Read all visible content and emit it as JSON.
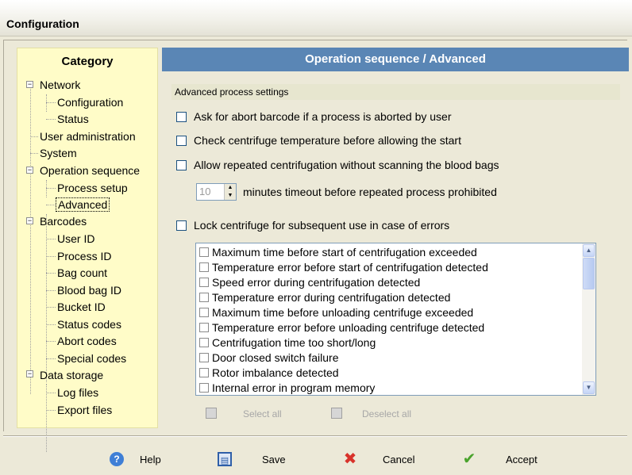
{
  "window": {
    "title": "Configuration"
  },
  "sidebar": {
    "title": "Category",
    "items": [
      {
        "label": "Network"
      },
      {
        "label": "Configuration"
      },
      {
        "label": "Status"
      },
      {
        "label": "User administration"
      },
      {
        "label": "System"
      },
      {
        "label": "Operation sequence"
      },
      {
        "label": "Process setup"
      },
      {
        "label": "Advanced"
      },
      {
        "label": "Barcodes"
      },
      {
        "label": "User ID"
      },
      {
        "label": "Process ID"
      },
      {
        "label": "Bag count"
      },
      {
        "label": "Blood bag ID"
      },
      {
        "label": "Bucket ID"
      },
      {
        "label": "Status codes"
      },
      {
        "label": "Abort codes"
      },
      {
        "label": "Special codes"
      },
      {
        "label": "Data storage"
      },
      {
        "label": "Log files"
      },
      {
        "label": "Export files"
      }
    ],
    "selected": "Advanced"
  },
  "main": {
    "header": "Operation sequence / Advanced",
    "section": "Advanced process settings",
    "options": [
      {
        "label": "Ask for abort barcode if a process is aborted by user",
        "checked": false
      },
      {
        "label": "Check centrifuge temperature before allowing the start",
        "checked": false
      },
      {
        "label": "Allow repeated centrifugation without scanning the blood bags",
        "checked": false
      }
    ],
    "timeout": {
      "value": "10",
      "label": "minutes timeout before repeated process prohibited"
    },
    "lock_option": {
      "label": "Lock centrifuge for subsequent use in case of errors",
      "checked": false
    },
    "errors": [
      "Maximum time before start of centrifugation exceeded",
      "Temperature error before start of centrifugation detected",
      "Speed error during centrifugation detected",
      "Temperature error during centrifugation detected",
      "Maximum time before unloading centrifuge exceeded",
      "Temperature error before unloading centrifuge detected",
      "Centrifugation time too short/long",
      "Door closed switch failure",
      "Rotor imbalance detected",
      "Internal error in program memory"
    ],
    "select_all": "Select all",
    "deselect_all": "Deselect all"
  },
  "footer": {
    "help": "Help",
    "save": "Save",
    "cancel": "Cancel",
    "accept": "Accept"
  },
  "colors": {
    "header_bg": "#5a86b5",
    "sidebar_bg": "#fffcc8",
    "window_bg": "#ece9d8"
  }
}
